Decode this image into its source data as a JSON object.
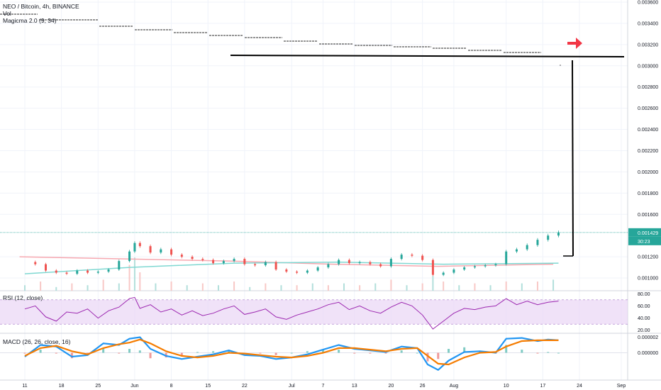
{
  "legend": {
    "symbol": "NEO / Bitcoin, 4h, BINANCE",
    "volume": "Vol",
    "indicator": "Magicma 2.0 (9, 34)",
    "rsi": "RSI (12, close)",
    "macd": "MACD (26, 26, close, 16)"
  },
  "colors": {
    "price_up": "#26a69a",
    "price_down": "#ef5350",
    "ma_slow": "#f7a8b0",
    "ma_fast": "#7fd8d2",
    "rsi_line": "#9c27b0",
    "rsi_band": "#e9d5f5",
    "macd_line": "#2196f3",
    "signal_line": "#f57c00",
    "annotation": "#000000",
    "arrow": "#f23645",
    "price_label_bg": "#26a69a"
  },
  "chart_data": [
    {
      "type": "line",
      "panel": "price",
      "ylim": [
        0.00088,
        0.0036
      ],
      "y_ticks": [
        "0.003600",
        "0.003400",
        "0.003200",
        "0.003000",
        "0.002800",
        "0.002600",
        "0.002400",
        "0.002200",
        "0.002000",
        "0.001800",
        "0.001600",
        "0.001200",
        "0.001000"
      ],
      "y_tick_values": [
        0.0036,
        0.0034,
        0.0032,
        0.003,
        0.0028,
        0.0026,
        0.0024,
        0.0022,
        0.002,
        0.0018,
        0.0016,
        0.0012,
        0.001
      ],
      "x_ticks": [
        "11",
        "18",
        "25",
        "Jun",
        "8",
        "15",
        "22",
        "Jul",
        "7",
        "13",
        "20",
        "26",
        "Aug",
        "10",
        "17",
        "24",
        "Sep"
      ],
      "x_tick_days": [
        0,
        7,
        14,
        21,
        28,
        35,
        42,
        51,
        57,
        63,
        70,
        76,
        82,
        92,
        99,
        106,
        114
      ],
      "last_price_label": "0.001429",
      "countdown_label": "30:23",
      "last_price": 0.001429,
      "close_points": [
        [
          0,
          0.00115
        ],
        [
          2,
          0.00113
        ],
        [
          4,
          0.00107
        ],
        [
          6,
          0.00105
        ],
        [
          8,
          0.00104
        ],
        [
          10,
          0.00107
        ],
        [
          12,
          0.00105
        ],
        [
          14,
          0.00106
        ],
        [
          16,
          0.00108
        ],
        [
          18,
          0.00116
        ],
        [
          20,
          0.00125
        ],
        [
          21,
          0.00133
        ],
        [
          22,
          0.0013
        ],
        [
          24,
          0.00124
        ],
        [
          26,
          0.00127
        ],
        [
          28,
          0.00122
        ],
        [
          30,
          0.0012
        ],
        [
          32,
          0.00118
        ],
        [
          34,
          0.00117
        ],
        [
          36,
          0.00114
        ],
        [
          38,
          0.00116
        ],
        [
          40,
          0.00118
        ],
        [
          42,
          0.00113
        ],
        [
          44,
          0.00112
        ],
        [
          46,
          0.00115
        ],
        [
          48,
          0.00108
        ],
        [
          50,
          0.00106
        ],
        [
          52,
          0.00105
        ],
        [
          54,
          0.00107
        ],
        [
          56,
          0.0011
        ],
        [
          58,
          0.00113
        ],
        [
          60,
          0.00117
        ],
        [
          62,
          0.00114
        ],
        [
          64,
          0.00115
        ],
        [
          66,
          0.00113
        ],
        [
          68,
          0.00111
        ],
        [
          70,
          0.00118
        ],
        [
          72,
          0.00122
        ],
        [
          74,
          0.00121
        ],
        [
          76,
          0.00117
        ],
        [
          78,
          0.00103
        ],
        [
          80,
          0.00105
        ],
        [
          82,
          0.00108
        ],
        [
          84,
          0.0011
        ],
        [
          86,
          0.00111
        ],
        [
          88,
          0.00112
        ],
        [
          90,
          0.00113
        ],
        [
          92,
          0.00125
        ],
        [
          94,
          0.00127
        ],
        [
          96,
          0.00131
        ],
        [
          98,
          0.00136
        ],
        [
          100,
          0.0014
        ],
        [
          102,
          0.00143
        ]
      ],
      "ma_slow_points": [
        [
          0,
          0.0012
        ],
        [
          20,
          0.00118
        ],
        [
          40,
          0.00116
        ],
        [
          60,
          0.00113
        ],
        [
          80,
          0.00111
        ],
        [
          102,
          0.00113
        ]
      ],
      "ma_fast_points": [
        [
          0,
          0.00104
        ],
        [
          20,
          0.0011
        ],
        [
          40,
          0.00114
        ],
        [
          60,
          0.00115
        ],
        [
          80,
          0.00113
        ],
        [
          102,
          0.00114
        ]
      ],
      "volume_points": [
        [
          0,
          3
        ],
        [
          3,
          5
        ],
        [
          6,
          2
        ],
        [
          9,
          4
        ],
        [
          12,
          3
        ],
        [
          15,
          6
        ],
        [
          18,
          4
        ],
        [
          20,
          14
        ],
        [
          21,
          18
        ],
        [
          22,
          10
        ],
        [
          25,
          4
        ],
        [
          28,
          5
        ],
        [
          31,
          3
        ],
        [
          34,
          4
        ],
        [
          37,
          3
        ],
        [
          40,
          5
        ],
        [
          43,
          2
        ],
        [
          46,
          4
        ],
        [
          49,
          3
        ],
        [
          52,
          3
        ],
        [
          55,
          4
        ],
        [
          58,
          3
        ],
        [
          61,
          4
        ],
        [
          64,
          3
        ],
        [
          67,
          4
        ],
        [
          70,
          6
        ],
        [
          73,
          3
        ],
        [
          76,
          4
        ],
        [
          78,
          8
        ],
        [
          80,
          5
        ],
        [
          83,
          3
        ],
        [
          86,
          4
        ],
        [
          89,
          3
        ],
        [
          92,
          5
        ],
        [
          95,
          4
        ],
        [
          98,
          5
        ],
        [
          101,
          6
        ]
      ]
    },
    {
      "type": "line",
      "panel": "rsi",
      "ylim": [
        15,
        85
      ],
      "y_ticks": [
        "80.00",
        "60.00",
        "40.00",
        "20.00"
      ],
      "y_tick_values": [
        80,
        60,
        40,
        20
      ],
      "band": [
        30,
        70
      ],
      "points": [
        [
          0,
          55
        ],
        [
          2,
          60
        ],
        [
          4,
          42
        ],
        [
          6,
          35
        ],
        [
          8,
          50
        ],
        [
          10,
          48
        ],
        [
          12,
          55
        ],
        [
          14,
          40
        ],
        [
          16,
          52
        ],
        [
          18,
          58
        ],
        [
          20,
          72
        ],
        [
          21,
          74
        ],
        [
          22,
          56
        ],
        [
          24,
          62
        ],
        [
          26,
          50
        ],
        [
          28,
          55
        ],
        [
          30,
          45
        ],
        [
          32,
          52
        ],
        [
          34,
          44
        ],
        [
          36,
          48
        ],
        [
          38,
          55
        ],
        [
          40,
          60
        ],
        [
          42,
          46
        ],
        [
          44,
          50
        ],
        [
          46,
          55
        ],
        [
          48,
          42
        ],
        [
          50,
          38
        ],
        [
          52,
          45
        ],
        [
          54,
          50
        ],
        [
          56,
          55
        ],
        [
          58,
          62
        ],
        [
          60,
          66
        ],
        [
          62,
          54
        ],
        [
          64,
          60
        ],
        [
          66,
          52
        ],
        [
          68,
          48
        ],
        [
          70,
          58
        ],
        [
          72,
          66
        ],
        [
          74,
          60
        ],
        [
          76,
          45
        ],
        [
          78,
          22
        ],
        [
          80,
          35
        ],
        [
          82,
          48
        ],
        [
          84,
          56
        ],
        [
          86,
          54
        ],
        [
          88,
          58
        ],
        [
          90,
          60
        ],
        [
          92,
          72
        ],
        [
          94,
          62
        ],
        [
          96,
          68
        ],
        [
          98,
          62
        ],
        [
          100,
          66
        ],
        [
          102,
          68
        ]
      ]
    },
    {
      "type": "line",
      "panel": "macd",
      "ylim": [
        -3.5e-06,
        2.5e-06
      ],
      "y_ticks": [
        "0.000002",
        "0.000000"
      ],
      "y_tick_values": [
        2e-06,
        0
      ],
      "series": [
        {
          "points": [
            [
              0,
              -5e-07
            ],
            [
              3,
              1e-06
            ],
            [
              6,
              8e-07
            ],
            [
              9,
              -5e-07
            ],
            [
              12,
              -3e-07
            ],
            [
              15,
              1.2e-06
            ],
            [
              18,
              1e-06
            ],
            [
              20,
              1.8e-06
            ],
            [
              22,
              2e-06
            ],
            [
              24,
              5e-07
            ],
            [
              27,
              -4e-07
            ],
            [
              30,
              -8e-07
            ],
            [
              33,
              -5e-07
            ],
            [
              36,
              -2e-07
            ],
            [
              39,
              3e-07
            ],
            [
              42,
              -3e-07
            ],
            [
              45,
              -4e-07
            ],
            [
              48,
              -8e-07
            ],
            [
              51,
              -6e-07
            ],
            [
              54,
              -2e-07
            ],
            [
              57,
              4e-07
            ],
            [
              60,
              1e-06
            ],
            [
              63,
              5e-07
            ],
            [
              66,
              3e-07
            ],
            [
              69,
              1e-07
            ],
            [
              72,
              8e-07
            ],
            [
              75,
              6e-07
            ],
            [
              77,
              -1.5e-06
            ],
            [
              79,
              -2.2e-06
            ],
            [
              81,
              -1e-06
            ],
            [
              84,
              1e-07
            ],
            [
              87,
              2e-07
            ],
            [
              90,
              0.0
            ],
            [
              92,
              1.8e-06
            ],
            [
              95,
              1.9e-06
            ],
            [
              98,
              1.5e-06
            ],
            [
              100,
              1.7e-06
            ],
            [
              102,
              1.6e-06
            ]
          ]
        },
        {
          "points": [
            [
              0,
              -4e-07
            ],
            [
              3,
              6e-07
            ],
            [
              6,
              9e-07
            ],
            [
              9,
              2e-07
            ],
            [
              12,
              -2e-07
            ],
            [
              15,
              6e-07
            ],
            [
              18,
              1.1e-06
            ],
            [
              20,
              1.3e-06
            ],
            [
              22,
              1.7e-06
            ],
            [
              24,
              1.2e-06
            ],
            [
              27,
              2e-07
            ],
            [
              30,
              -4e-07
            ],
            [
              33,
              -6e-07
            ],
            [
              36,
              -4e-07
            ],
            [
              39,
              0.0
            ],
            [
              42,
              -1e-07
            ],
            [
              45,
              -3e-07
            ],
            [
              48,
              -5e-07
            ],
            [
              51,
              -6e-07
            ],
            [
              54,
              -4e-07
            ],
            [
              57,
              0.0
            ],
            [
              60,
              6e-07
            ],
            [
              63,
              6e-07
            ],
            [
              66,
              4e-07
            ],
            [
              69,
              2e-07
            ],
            [
              72,
              5e-07
            ],
            [
              75,
              6e-07
            ],
            [
              77,
              -4e-07
            ],
            [
              79,
              -1.4e-06
            ],
            [
              81,
              -1.5e-06
            ],
            [
              84,
              -6e-07
            ],
            [
              87,
              0.0
            ],
            [
              90,
              1e-07
            ],
            [
              92,
              8e-07
            ],
            [
              95,
              1.5e-06
            ],
            [
              98,
              1.6e-06
            ],
            [
              100,
              1.6e-06
            ],
            [
              102,
              1.6e-06
            ]
          ]
        }
      ]
    }
  ]
}
